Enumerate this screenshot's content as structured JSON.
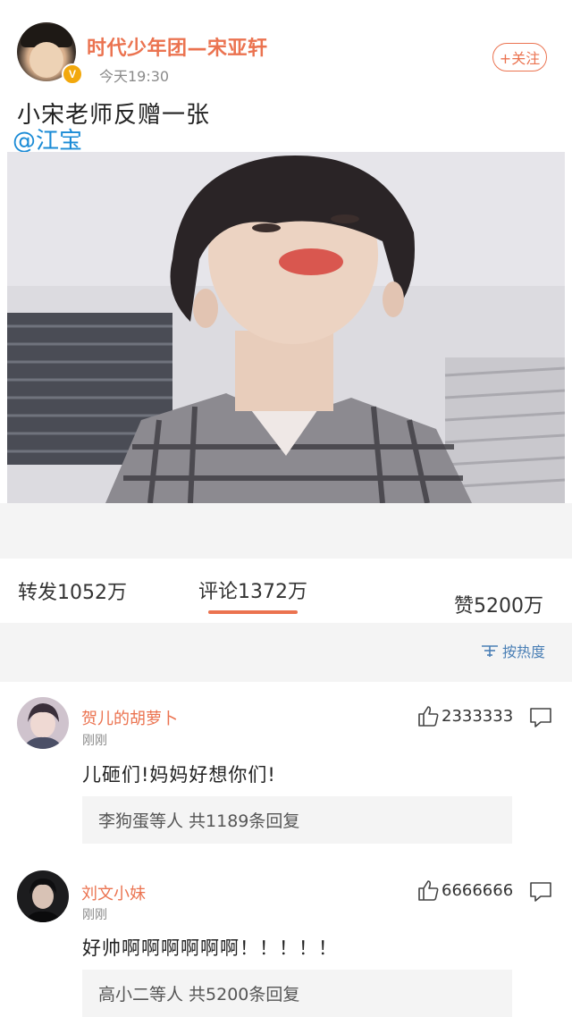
{
  "post": {
    "username": "时代少年团—宋亚轩",
    "badge": "V",
    "time": "今天19:30",
    "follow_label": "+关注",
    "text": "小宋老师反赠一张",
    "mention": "@江宝"
  },
  "tabs": {
    "repost": "转发1052万",
    "comments": "评论1372万",
    "likes": "赞5200万"
  },
  "sort": {
    "label": "按热度"
  },
  "comments": [
    {
      "user": "贺儿的胡萝卜",
      "time": "刚刚",
      "text": "儿砸们!妈妈好想你们!",
      "likes": "2333333",
      "replies": "李狗蛋等人 共1189条回复"
    },
    {
      "user": "刘文小妹",
      "time": "刚刚",
      "text": "好帅啊啊啊啊啊啊！！！！！",
      "likes": "6666666",
      "replies": "高小二等人 共5200条回复"
    }
  ],
  "colors": {
    "accent": "#eb7350",
    "mention": "#1a8bd6",
    "verified": "#f2a80c",
    "sort": "#4a7fb5"
  },
  "icons": [
    "verified-badge-icon",
    "thumbs-up-icon",
    "comment-bubble-icon",
    "sort-icon"
  ]
}
